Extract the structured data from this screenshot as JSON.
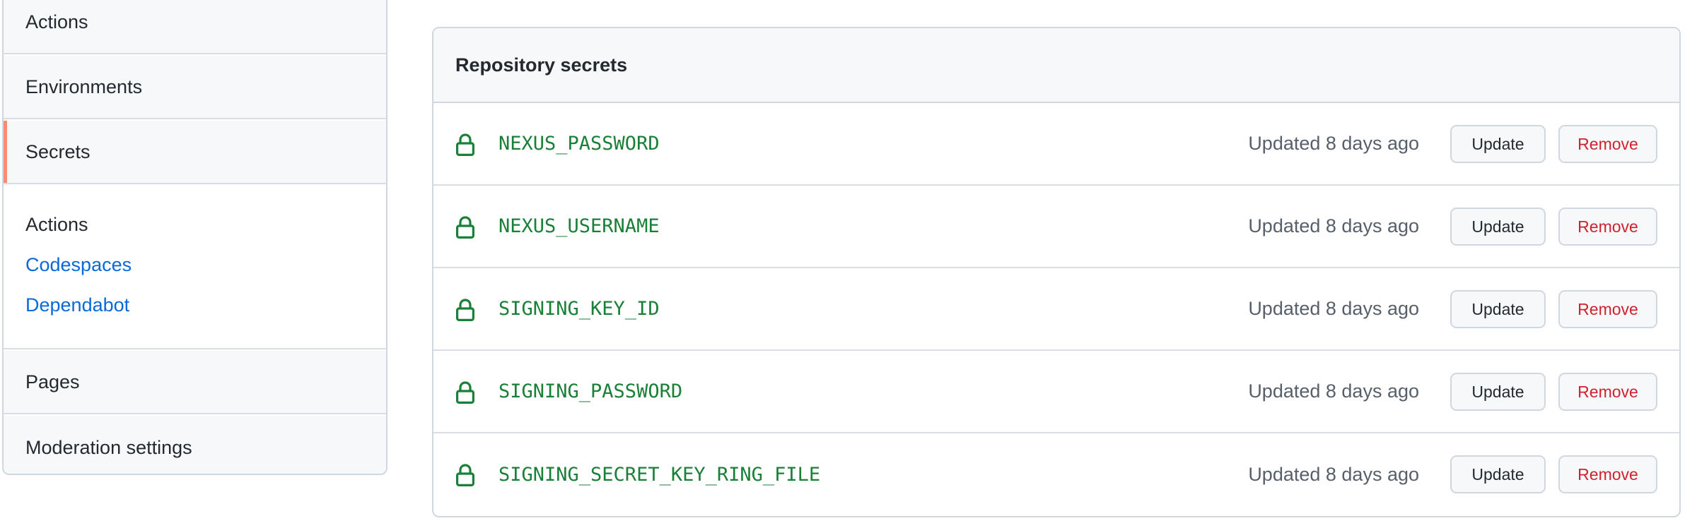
{
  "sidebar": {
    "items_top": [
      {
        "label": "Actions"
      },
      {
        "label": "Environments"
      },
      {
        "label": "Secrets",
        "selected": true
      }
    ],
    "secrets_subsection": {
      "heading": "Actions",
      "links": [
        {
          "label": "Codespaces"
        },
        {
          "label": "Dependabot"
        }
      ]
    },
    "items_bottom": [
      {
        "label": "Pages"
      },
      {
        "label": "Moderation settings"
      }
    ]
  },
  "secrets_box": {
    "title": "Repository secrets",
    "update_label": "Update",
    "remove_label": "Remove",
    "rows": [
      {
        "name": "NEXUS_PASSWORD",
        "updated": "Updated 8 days ago"
      },
      {
        "name": "NEXUS_USERNAME",
        "updated": "Updated 8 days ago"
      },
      {
        "name": "SIGNING_KEY_ID",
        "updated": "Updated 8 days ago"
      },
      {
        "name": "SIGNING_PASSWORD",
        "updated": "Updated 8 days ago"
      },
      {
        "name": "SIGNING_SECRET_KEY_RING_FILE",
        "updated": "Updated 8 days ago"
      }
    ]
  },
  "icons": {
    "lock": "lock-icon"
  },
  "colors": {
    "secret_name": "#1a7f37",
    "link": "#0969da",
    "remove": "#cf222e",
    "selected_indicator": "#fd8c73",
    "muted_text": "#57606a"
  }
}
